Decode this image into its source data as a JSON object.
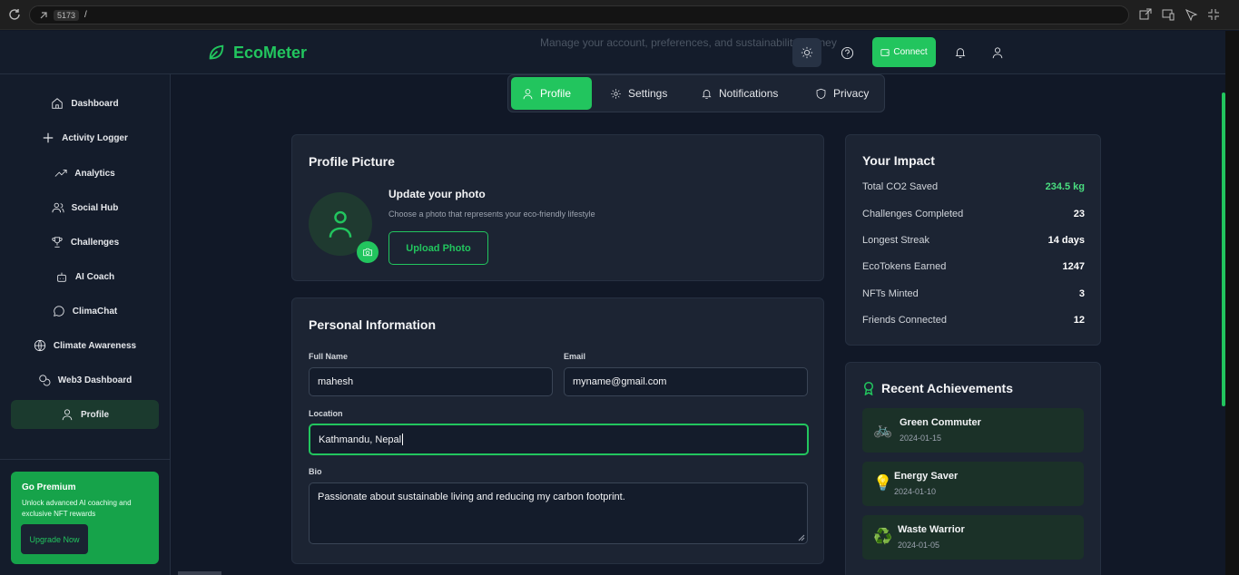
{
  "browser": {
    "port": "5173",
    "path": "/"
  },
  "header": {
    "app_name": "EcoMeter",
    "connect_label": "Connect",
    "ghost_text": "Manage your account, preferences, and sustainability journey"
  },
  "sidebar": {
    "items": [
      {
        "label": "Dashboard"
      },
      {
        "label": "Activity Logger"
      },
      {
        "label": "Analytics"
      },
      {
        "label": "Social Hub"
      },
      {
        "label": "Challenges"
      },
      {
        "label": "AI Coach"
      },
      {
        "label": "ClimaChat"
      },
      {
        "label": "Climate Awareness"
      },
      {
        "label": "Web3 Dashboard"
      },
      {
        "label": "Profile"
      }
    ],
    "active": "Profile",
    "premium": {
      "title": "Go Premium",
      "description": "Unlock advanced AI coaching and exclusive NFT rewards",
      "button": "Upgrade Now"
    }
  },
  "tabs": [
    {
      "label": "Profile"
    },
    {
      "label": "Settings"
    },
    {
      "label": "Notifications"
    },
    {
      "label": "Privacy"
    }
  ],
  "profile_picture": {
    "title": "Profile Picture",
    "update_title": "Update your photo",
    "update_desc": "Choose a photo that represents your eco-friendly lifestyle",
    "upload_label": "Upload Photo"
  },
  "personal_info": {
    "title": "Personal Information",
    "full_name_label": "Full Name",
    "full_name": "mahesh",
    "email_label": "Email",
    "email": "myname@gmail.com",
    "location_label": "Location",
    "location": "Kathmandu, Nepal",
    "bio_label": "Bio",
    "bio": "Passionate about sustainable living and reducing my carbon footprint."
  },
  "impact": {
    "title": "Your Impact",
    "stats": [
      {
        "label": "Total CO2 Saved",
        "value": "234.5 kg"
      },
      {
        "label": "Challenges Completed",
        "value": "23"
      },
      {
        "label": "Longest Streak",
        "value": "14 days"
      },
      {
        "label": "EcoTokens Earned",
        "value": "1247"
      },
      {
        "label": "NFTs Minted",
        "value": "3"
      },
      {
        "label": "Friends Connected",
        "value": "12"
      }
    ]
  },
  "achievements": {
    "title": "Recent Achievements",
    "items": [
      {
        "name": "Green Commuter",
        "date": "2024-01-15",
        "emoji": "🚲"
      },
      {
        "name": "Energy Saver",
        "date": "2024-01-10",
        "emoji": "💡"
      },
      {
        "name": "Waste Warrior",
        "date": "2024-01-05",
        "emoji": "♻️"
      }
    ]
  },
  "colors": {
    "accent": "#22c55e",
    "background": "#111827",
    "panel": "#1c2433"
  }
}
